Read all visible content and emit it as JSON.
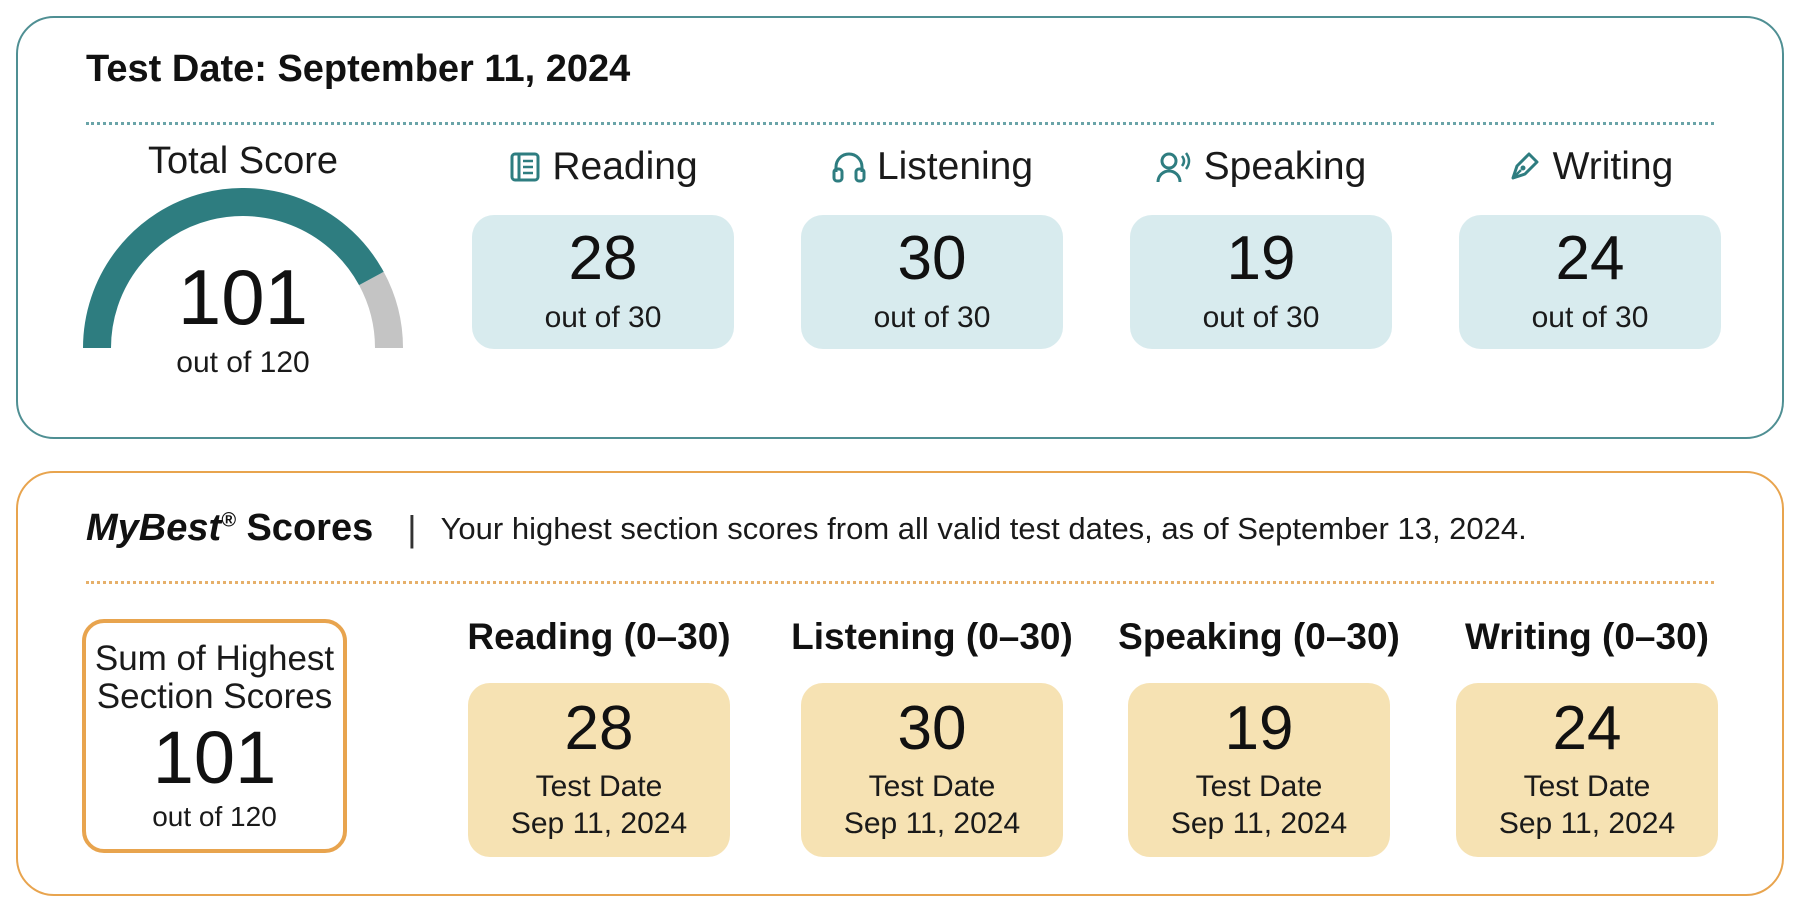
{
  "test_panel": {
    "heading": "Test Date: September 11, 2024",
    "total": {
      "title": "Total Score",
      "value": "101",
      "out_of": "out of 120",
      "fraction": 0.842
    },
    "sections": [
      {
        "label": "Reading",
        "icon": "book-icon",
        "score": "28",
        "out_of": "out of 30"
      },
      {
        "label": "Listening",
        "icon": "headphones-icon",
        "score": "30",
        "out_of": "out of 30"
      },
      {
        "label": "Speaking",
        "icon": "speaking-person-icon",
        "score": "19",
        "out_of": "out of 30"
      },
      {
        "label": "Writing",
        "icon": "pen-icon",
        "score": "24",
        "out_of": "out of 30"
      }
    ]
  },
  "best_panel": {
    "title_italic": "MyBest",
    "title_reg": "®",
    "title_rest": " Scores",
    "separator": "|",
    "description": "Your highest section scores from all valid test dates, as of September 13, 2024.",
    "sum": {
      "label": "Sum of Highest Section Scores",
      "value": "101",
      "out_of": "out of 120"
    },
    "sections": [
      {
        "label": "Reading (0–30)",
        "score": "28",
        "date_label": "Test Date",
        "date": "Sep 11, 2024"
      },
      {
        "label": "Listening (0–30)",
        "score": "30",
        "date_label": "Test Date",
        "date": "Sep 11, 2024"
      },
      {
        "label": "Speaking (0–30)",
        "score": "19",
        "date_label": "Test Date",
        "date": "Sep 11, 2024"
      },
      {
        "label": "Writing (0–30)",
        "score": "24",
        "date_label": "Test Date",
        "date": "Sep 11, 2024"
      }
    ]
  },
  "colors": {
    "teal_border": "#4f8f93",
    "gauge_fill": "#2e7d80",
    "gauge_track": "#c4c4c4",
    "teal_box": "#d8ebee",
    "orange_border": "#e8a44e",
    "gold_box": "#f6e2b3"
  }
}
